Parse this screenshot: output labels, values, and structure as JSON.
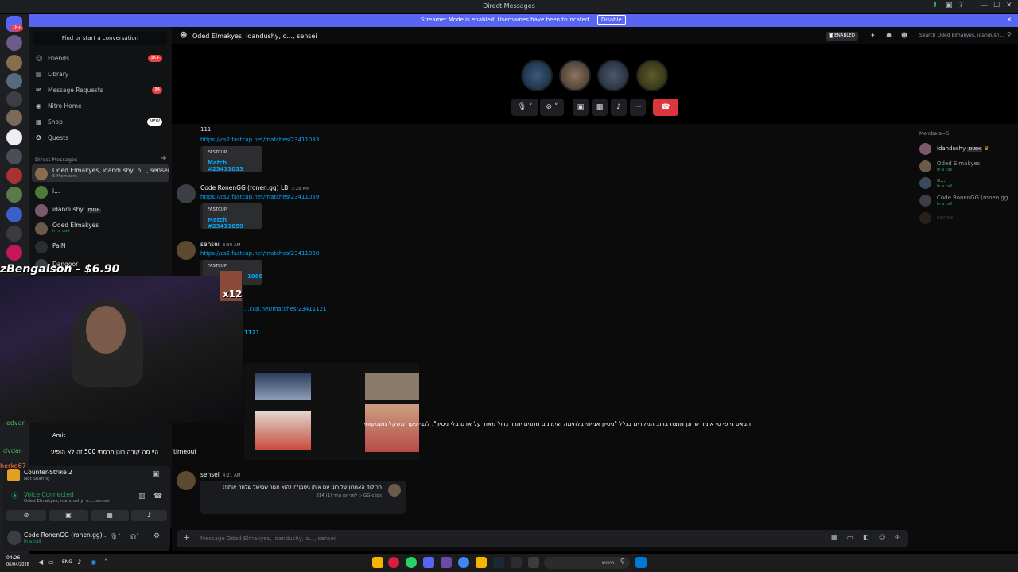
{
  "window": {
    "title": "Direct Messages",
    "controls": [
      "—",
      "☐",
      "✕"
    ]
  },
  "banner": {
    "text": "Streamer Mode is enabled. Usernames have been truncated.",
    "button": "Disable"
  },
  "guilds": {
    "home_badge": "1K+",
    "server_badges": [
      "",
      "",
      "",
      "",
      "2",
      "",
      "",
      "",
      "",
      "1",
      "",
      "",
      "",
      ""
    ]
  },
  "sidebar": {
    "search_placeholder": "Find or start a conversation",
    "nav": [
      {
        "label": "Friends",
        "icon": "friends-icon",
        "badge": "1K+"
      },
      {
        "label": "Library",
        "icon": "library-icon",
        "badge": ""
      },
      {
        "label": "Message Requests",
        "icon": "mail-icon",
        "badge": "34"
      },
      {
        "label": "Nitro Home",
        "icon": "nitro-icon",
        "badge": ""
      },
      {
        "label": "Shop",
        "icon": "shop-icon",
        "badge": "NEW"
      },
      {
        "label": "Quests",
        "icon": "quests-icon",
        "badge": ""
      }
    ],
    "dm_header": "Direct Messages",
    "dms": [
      {
        "name": "Oded Elmakyes, idandushy, o..., sensei",
        "sub": "5 Members",
        "tag": "",
        "selected": true
      },
      {
        "name": "i...",
        "sub": "",
        "tag": ""
      },
      {
        "name": "idandushy",
        "sub": "",
        "tag": "DUSH"
      },
      {
        "name": "Oded Elmakyes",
        "sub": "In a call",
        "tag": ""
      },
      {
        "name": "PalN",
        "sub": "",
        "tag": ""
      },
      {
        "name": "Dangoor",
        "sub": "",
        "tag": ""
      }
    ]
  },
  "header": {
    "channel_name": "Oded Elmakyes, idandushy, o..., sensei",
    "streamer_badge": "ENABLED",
    "search_placeholder": "Search Oded Elmakyes, idandush..."
  },
  "messages": [
    {
      "author": "",
      "time": "",
      "text": "111",
      "link": "https://cs2.fastcup.net/matches/23411033",
      "embed_provider": "FASTCUP",
      "embed_title": "Match #23411033"
    },
    {
      "author": "Code RonenGG (ronen.gg) LB",
      "time": "3:28 AM",
      "text": "",
      "link": "https://cs2.fastcup.net/matches/23411059",
      "embed_provider": "FASTCUP",
      "embed_title": "Match #23411059"
    },
    {
      "author": "sensei",
      "time": "3:30 AM",
      "text": "",
      "link": "https://cs2.fastcup.net/matches/23411068",
      "embed_provider": "FASTCUP",
      "embed_title": "1068"
    },
    {
      "author": "",
      "time": "",
      "text": "",
      "link": "...cup.net/matches/23411121",
      "embed_provider": "",
      "embed_title": "1121"
    },
    {
      "author": "sensei",
      "time": "4:21 AM",
      "text": "",
      "link": "",
      "embed_provider": "GG-clips",
      "embed_title": "הריקוד האחרון של רונן עם איתן גיטמן?? (הוא אמר שמישל שלחה אותו!)",
      "embed_meta": "לפני יום אחד (1) 814"
    }
  ],
  "members": {
    "header": "Members—5",
    "list": [
      {
        "name": "idandushy",
        "tag": "DUSH",
        "status": ""
      },
      {
        "name": "Oded Elmakyes",
        "tag": "",
        "status": "In a call"
      },
      {
        "name": "o...",
        "tag": "",
        "status": "In a call"
      },
      {
        "name": "Code RonenGG (ronen.gg...",
        "tag": "",
        "status": "In a call"
      },
      {
        "name": "sensei",
        "tag": "",
        "status": ""
      }
    ]
  },
  "composer": {
    "placeholder": "Message Oded Elmakyes, idandushy, o..., sensei"
  },
  "user_panel": {
    "activity_title": "Counter-Strike 2",
    "activity_sub": "Not Sharing",
    "voice_title": "Voice Connected",
    "voice_sub": "Oded Elmakyes, idandushy, o..., sensei",
    "username": "Code RonenGG (ronen.gg)...",
    "status": "In a call"
  },
  "stream_overlay": {
    "donation": "zBengalson - $6.90",
    "multiplier": "x12",
    "chat_lines": [
      "הבאס גי פי סי אומר שרונן מנצח ברוב המקרים בגלל \"ניסיון אמיתי בלחימה ואימונים מתנים יתרון גדול מאוד על אדם בלי ניסיון\". לגבי פער משקל משמעותי",
      "היי מה קורה רונן תרמתי 500 זה לא הופיע",
      "timeout"
    ],
    "chat_names": [
      "edvar",
      "Amit",
      "dvdar",
      "herko67"
    ]
  },
  "taskbar": {
    "time": "04:26",
    "date": "06/04/2026",
    "lang": "ENG",
    "search_placeholder": "חיפוש"
  },
  "colors": {
    "accent": "#5865f2",
    "danger": "#da373c",
    "link": "#00a8fc",
    "voice": "#23a55a"
  }
}
